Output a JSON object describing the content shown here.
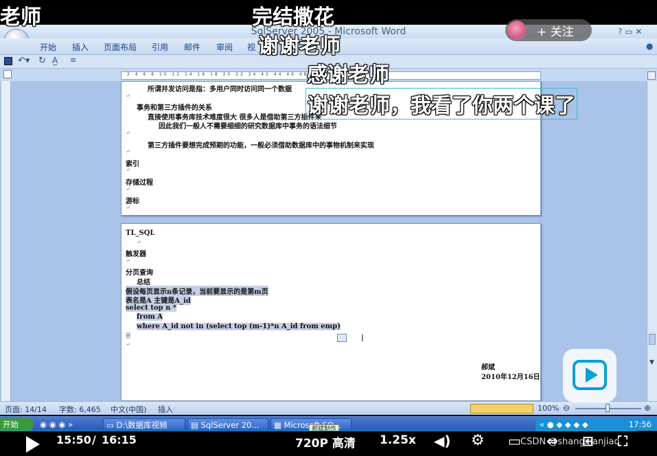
{
  "video_overlay": {
    "top_left_text": "老师",
    "danmaku": [
      "完结撒花",
      "谢谢老师",
      "感谢老师",
      "谢谢老师，我看了你两个课了"
    ],
    "follow_label": "+ 关注",
    "progress": 0.9688,
    "current_time": "15:50",
    "time_separator": "/",
    "total_time": "16:15",
    "quality": "720P 高清",
    "speed": "1.25x",
    "watermark": "CSDN @shangxianjiao",
    "accent_color": "#00a1d6"
  },
  "word": {
    "title": "SqlServer 2005 - Microsoft Word",
    "title_visible_left": "SqlServ",
    "title_visible_right": "- Microsoft Word",
    "ribbon_tabs": [
      "开始",
      "插入",
      "页面布局",
      "引用",
      "邮件",
      "审阅",
      "视"
    ],
    "ruler_text": "2 4 6 8 10 12 14 16 18 20 22 24 42 44 46 48 50 52 54 56",
    "page1": [
      {
        "text": "所谓并发访问是指：多用户同时访问同一个数据",
        "indent": 2,
        "bold": true
      },
      {
        "text": "↵",
        "mark": true
      },
      {
        "text": "事务和第三方插件的关系",
        "indent": 1,
        "bold": true
      },
      {
        "text": "直接使用事务库技术难度很大 很多人是借助第三方插件来",
        "indent": 2,
        "bold": true
      },
      {
        "text": "因此我们一般人不需要细细的研究数据库中事务的语法细节",
        "indent": 3,
        "bold": true
      },
      {
        "text": "↵",
        "mark": true
      },
      {
        "text": "第三方插件要想完成预期的功能，一般必须借助数据库中的事物机制来实现",
        "indent": 2,
        "bold": true
      },
      {
        "text": "↵",
        "mark": true
      },
      {
        "text": "索引",
        "indent": 0,
        "bold": true
      },
      {
        "text": "↵",
        "mark": true
      },
      {
        "text": "存储过程",
        "indent": 0,
        "bold": true
      },
      {
        "text": "↵",
        "mark": true
      },
      {
        "text": "游标",
        "indent": 0,
        "bold": true
      },
      {
        "text": "↵",
        "mark": true
      }
    ],
    "page2": [
      {
        "text": "TL_SQL",
        "bold": true
      },
      {
        "text": "↵",
        "mark": true,
        "indent": 1
      },
      {
        "text": "触发器",
        "bold": true
      },
      {
        "text": "↵",
        "mark": true
      },
      {
        "text": "分页查询",
        "bold": true
      },
      {
        "text": "总结",
        "bold": true,
        "indent": 1
      },
      {
        "text": "假设每页显示n条记录，当前要显示的是第m页",
        "bold": true,
        "sel": true
      },
      {
        "text": "表名是A  主键是A_id",
        "bold": true,
        "sel": true
      },
      {
        "text": "select top n *",
        "bold": true,
        "sel": true
      },
      {
        "text": "from A",
        "bold": true,
        "sel": true,
        "indent": 1
      },
      {
        "text": "where A_id not in (select top  (m-1)*n  A_id from emp)",
        "bold": true,
        "sel": true,
        "indent": 1
      },
      {
        "text": "↵",
        "mark": true,
        "sel": true
      },
      {
        "text": "↵",
        "mark": true
      }
    ],
    "signature_name": "郝斌",
    "signature_date": "2010年12月16日",
    "status": {
      "page": "页面: 14/14",
      "words": "字数: 6,465",
      "language": "中文(中国)",
      "mode": "插入",
      "zoom": "100%"
    }
  },
  "taskbar": {
    "start": "开始",
    "items": [
      "D:\\数据库视频",
      "SqlServer 20...",
      "Microsoft SQ..."
    ],
    "tooltip": "郝斌制作",
    "clock": "17:56"
  }
}
